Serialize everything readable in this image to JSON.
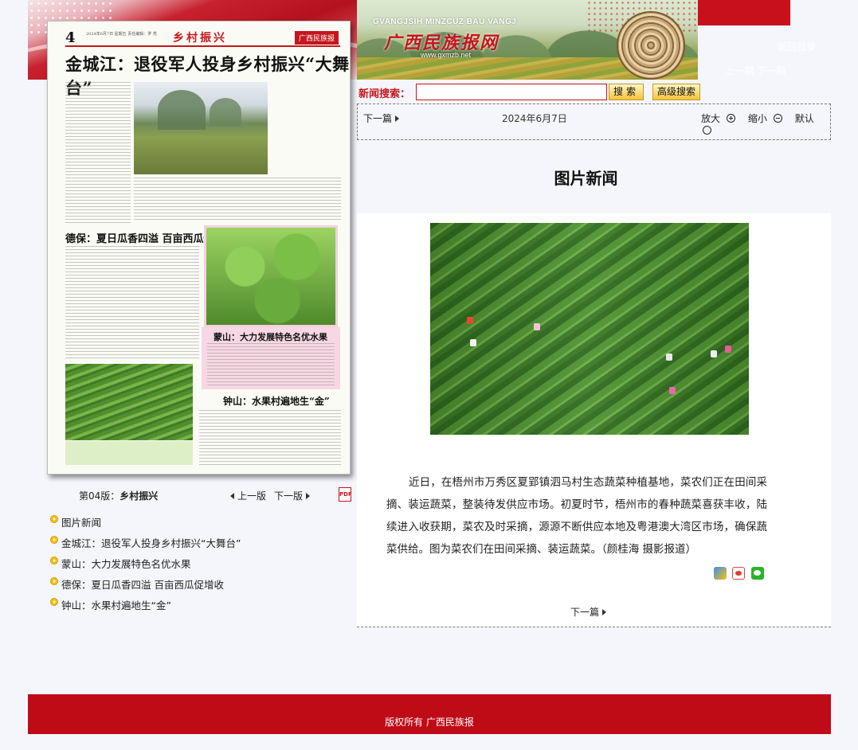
{
  "banner": {
    "pinyin": "GVANGJSIH MINZCUZ BAU VANGJ",
    "logo_text": "广西民族报网",
    "url_text": "www.gxmzb.net",
    "tool_link_1": "返回目录",
    "tool_link_2": "上一期  下一期"
  },
  "newspaper": {
    "page_number": "4",
    "page_date": "2024年6月7日 星期五 责任编辑：罗 亮",
    "section": "乡村振兴",
    "brand": "广西民族报",
    "headline": "金城江：退役军人投身乡村振兴“大舞台”",
    "subhead_1": "德保：夏日瓜香四溢 百亩西瓜促增收",
    "subhead_2": "蒙山：大力发展特色名优水果",
    "subhead_3": "钟山：水果村遍地生“金”"
  },
  "page_nav": {
    "edition_prefix": "第04版：",
    "edition_name": "乡村振兴",
    "prev_label": "上一版",
    "next_label": "下一版",
    "pdf_label": "PDF"
  },
  "articles": [
    {
      "title": "图片新闻"
    },
    {
      "title": "金城江：退役军人投身乡村振兴“大舞台”"
    },
    {
      "title": "蒙山：大力发展特色名优水果"
    },
    {
      "title": "德保：夏日瓜香四溢 百亩西瓜促增收"
    },
    {
      "title": "钟山：水果村遍地生“金”"
    }
  ],
  "search": {
    "label": "新闻搜索：",
    "value": "",
    "button": "搜索",
    "advanced_button": "高级搜索"
  },
  "toolbar": {
    "next_label": "下一篇",
    "date": "2024年6月7日",
    "zoom_in": "放大",
    "zoom_out": "缩小",
    "default": "默认"
  },
  "article": {
    "title": "图片新闻",
    "body": "近日，在梧州市万秀区夏郢镇泗马村生态蔬菜种植基地，菜农们正在田间采摘、装运蔬菜，整装待发供应市场。初夏时节，梧州市的春种蔬菜喜获丰收，陆续进入收获期，菜农及时采摘，源源不断供应本地及粤港澳大湾区市场，确保蔬菜供给。图为菜农们在田间采摘、装运蔬菜。（颜桂海 摄影报道）",
    "bottom_next_label": "下一篇"
  },
  "footer": {
    "copyright": "版权所有 广西民族报"
  },
  "colors": {
    "brand_red": "#c4161c",
    "footer_red": "#bf0b16",
    "background": "#f4f6fb"
  }
}
